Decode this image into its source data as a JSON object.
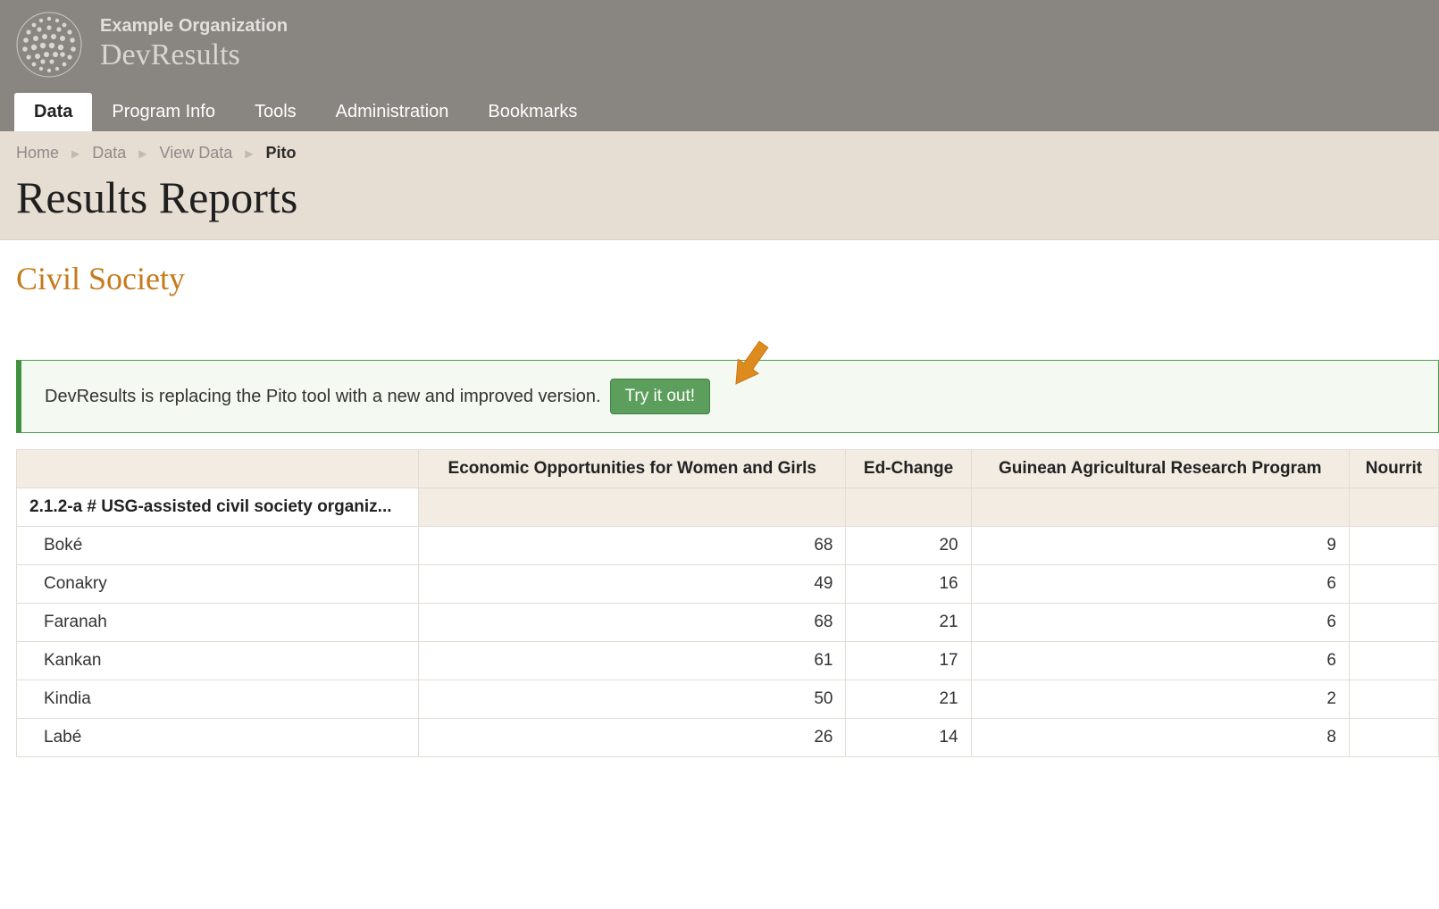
{
  "header": {
    "org_name": "Example Organization",
    "app_name": "DevResults"
  },
  "nav": {
    "items": [
      {
        "label": "Data",
        "active": true
      },
      {
        "label": "Program Info"
      },
      {
        "label": "Tools"
      },
      {
        "label": "Administration"
      },
      {
        "label": "Bookmarks"
      }
    ]
  },
  "breadcrumbs": {
    "items": [
      "Home",
      "Data",
      "View Data"
    ],
    "current": "Pito"
  },
  "page_title": "Results Reports",
  "section_title": "Civil Society",
  "alert": {
    "message": "DevResults is replacing the Pito tool with a new and improved version.",
    "button_label": "Try it out!"
  },
  "table": {
    "columns": [
      "",
      "Economic Opportunities for Women and Girls",
      "Ed-Change",
      "Guinean Agricultural Research Program",
      "Nourrit"
    ],
    "group_label": "2.1.2-a # USG-assisted civil society organiz...",
    "rows": [
      {
        "region": "Boké",
        "values": [
          68,
          20,
          9,
          null
        ]
      },
      {
        "region": "Conakry",
        "values": [
          49,
          16,
          6,
          null
        ]
      },
      {
        "region": "Faranah",
        "values": [
          68,
          21,
          6,
          null
        ]
      },
      {
        "region": "Kankan",
        "values": [
          61,
          17,
          6,
          null
        ]
      },
      {
        "region": "Kindia",
        "values": [
          50,
          21,
          2,
          null
        ]
      },
      {
        "region": "Labé",
        "values": [
          26,
          14,
          8,
          null
        ]
      }
    ]
  }
}
